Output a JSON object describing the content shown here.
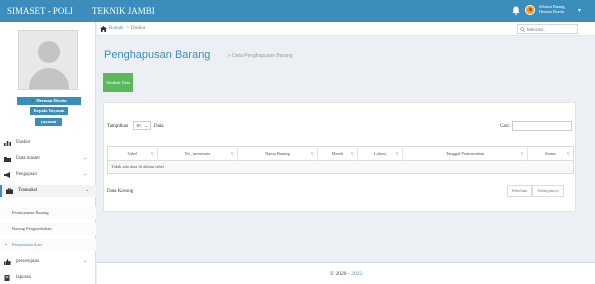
{
  "app": {
    "brand_left": "SIMASET - POLI",
    "brand_right": "TEKNIK JAMBI"
  },
  "topbar": {
    "greeting": "Selamat Datang,",
    "user": "Herman Hosein",
    "colors": {
      "header": "#3c8dbc",
      "bell": "#d73925",
      "avatar": "#f39c12"
    }
  },
  "sidebar": {
    "user_name": "Herman Hosein",
    "user_role": "Kepala Yayasan",
    "user_company": "yayasan",
    "menu": [
      {
        "label": "Dasbor",
        "icon": "dashboard-icon"
      },
      {
        "label": "Data master",
        "icon": "folder-icon"
      },
      {
        "label": "Pengajuan",
        "icon": "megaphone-icon"
      },
      {
        "label": "Transaksi",
        "icon": "briefcase-icon"
      },
      {
        "label": "persetujuan",
        "icon": "thumbs-up-icon"
      },
      {
        "label": "laporan",
        "icon": "report-icon"
      }
    ],
    "submenu": [
      {
        "label": "Peminjaman Barang"
      },
      {
        "label": "Barang Pengembalian"
      },
      {
        "label": "Penyusutan Aset"
      }
    ]
  },
  "breadcrumb": {
    "home": "Rumah",
    "separator": ">",
    "current": "Dasbor"
  },
  "search": {
    "placeholder": "Mencari..."
  },
  "page": {
    "title": "Penghapusan Barang",
    "subtitle": "» Data Penghapusan Barang",
    "add_button": "Tambah Data"
  },
  "table_controls": {
    "length_label": "Tampilkan",
    "length_value": "10",
    "length_after": "Data",
    "search_label": "Cari:"
  },
  "table": {
    "columns": [
      "Tabel",
      "No_inventaris",
      "Nama Barang",
      "Merek",
      "Lokasi",
      "Tanggal Pemusnahan",
      "Status"
    ],
    "sort_glyph": "⇅",
    "empty_message": "Tidak ada data di dalam tabel"
  },
  "pagination": {
    "info": "Data Kosong",
    "prev": "Sebelum",
    "next": "Selanjutnya"
  },
  "footer": {
    "prefix": "© 2020 - ",
    "year": "2022"
  }
}
